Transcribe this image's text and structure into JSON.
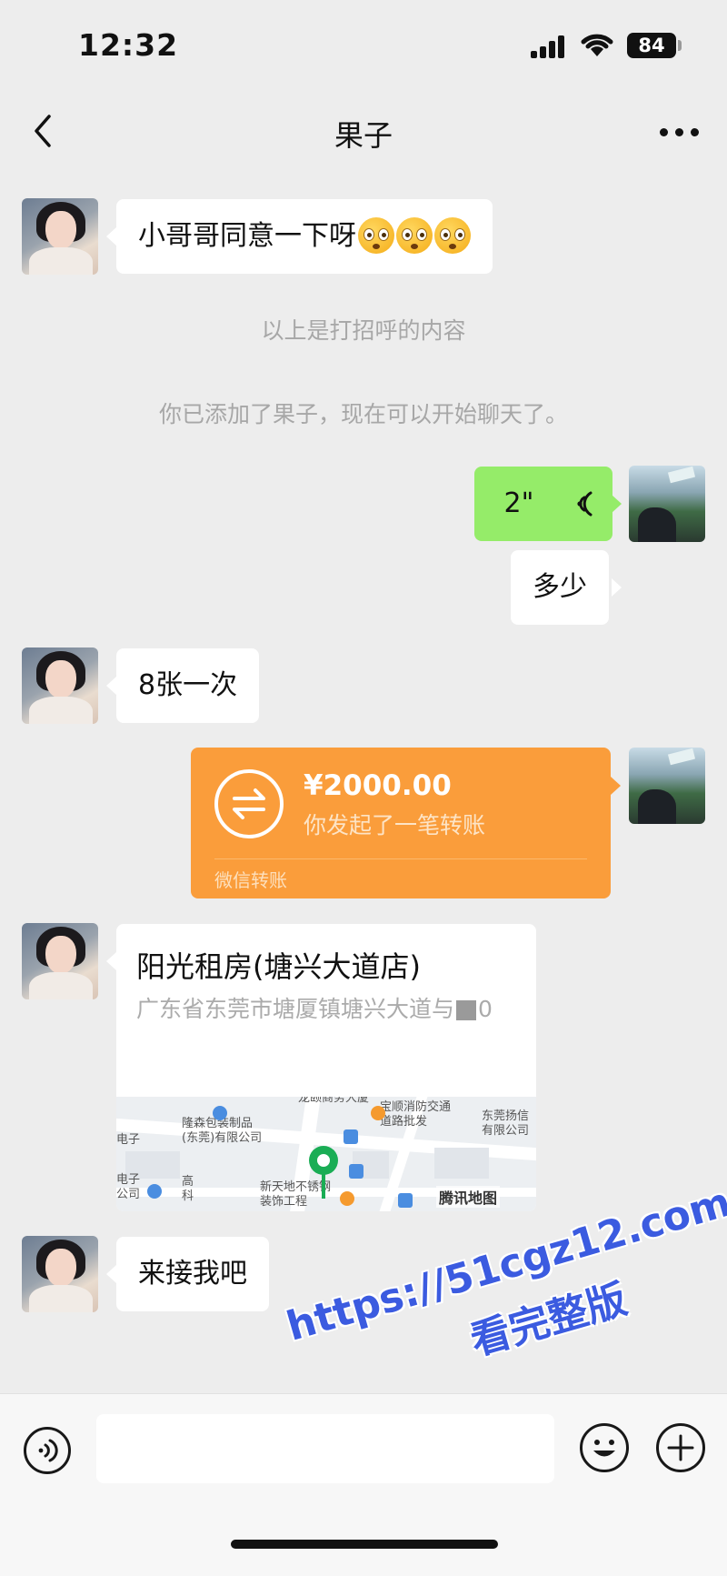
{
  "status_bar": {
    "time": "12:32",
    "battery": "84"
  },
  "nav": {
    "title": "果子"
  },
  "messages": {
    "greeting": "小哥哥同意一下呀",
    "greeting_hint": "以上是打招呼的内容",
    "added_notice": "你已添加了果子，现在可以开始聊天了。",
    "voice_duration": "2\"",
    "how_much": "多少",
    "reply_price": "8张一次",
    "transfer": {
      "amount": "¥2000.00",
      "description": "你发起了一笔转账",
      "footer": "微信转账"
    },
    "location": {
      "name": "阳光租房(塘兴大道店)",
      "address": "广东省东莞市塘厦镇塘兴大道与",
      "map_labels": [
        "龙颐商务大厦",
        "宝顺消防交通",
        "道路批发",
        "东莞扬信",
        "有限公司",
        "隆森包装制品",
        "(东莞)有限公司",
        "电子",
        "电子",
        "公司",
        "高",
        "科",
        "新天地不锈钢",
        "装饰工程",
        "腾讯地图"
      ]
    },
    "pickup": "来接我吧"
  },
  "watermark": {
    "line1": "https://51cgz12.com",
    "line2": "看完整版"
  },
  "colors": {
    "self_bubble": "#95ec69",
    "transfer_card": "#fa9d3b",
    "background": "#ededed",
    "map_pin": "#1aad55"
  },
  "icons": [
    "back-icon",
    "more-icon",
    "voice-wave-icon",
    "transfer-arrows-icon",
    "map-pin-icon",
    "voice-input-icon",
    "emoji-icon",
    "plus-icon"
  ]
}
